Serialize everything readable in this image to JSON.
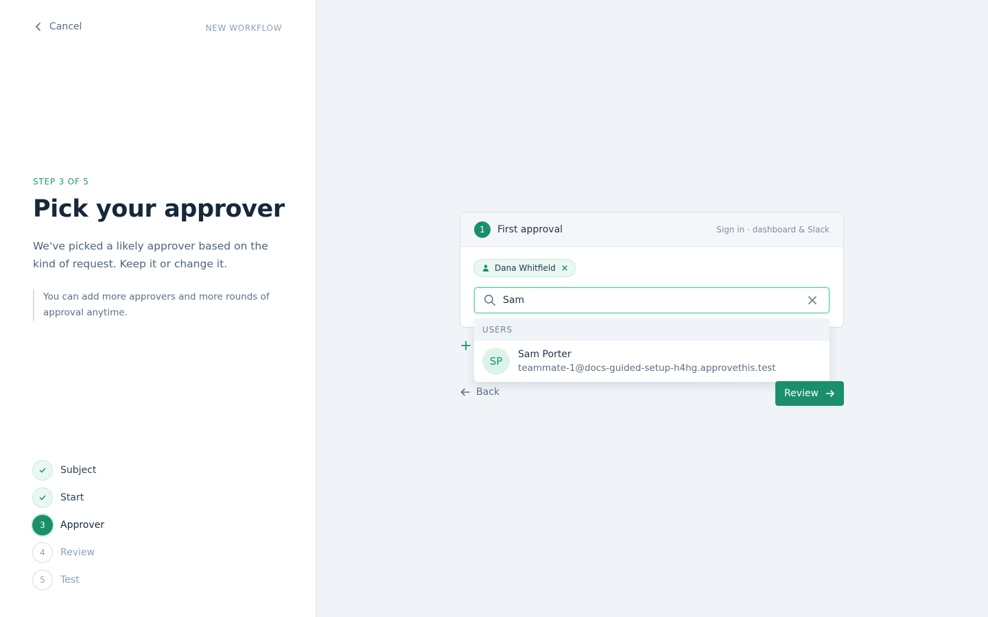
{
  "header": {
    "cancel_label": "Cancel",
    "context_label": "NEW WORKFLOW"
  },
  "intro": {
    "step_label": "STEP 3 OF 5",
    "title": "Pick your approver",
    "description": "We've picked a likely approver based on the kind of request. Keep it or change it.",
    "note": "You can add more approvers and more rounds of approval anytime."
  },
  "steps": [
    {
      "number": "1",
      "label": "Subject",
      "state": "done"
    },
    {
      "number": "2",
      "label": "Start",
      "state": "done"
    },
    {
      "number": "3",
      "label": "Approver",
      "state": "active"
    },
    {
      "number": "4",
      "label": "Review",
      "state": "todo"
    },
    {
      "number": "5",
      "label": "Test",
      "state": "todo"
    }
  ],
  "approval_card": {
    "number": "1",
    "title": "First approval",
    "subtitle": "Sign in · dashboard & Slack",
    "selected_approver": "Dana Whitfield",
    "search": {
      "value": "Sam",
      "placeholder": ""
    }
  },
  "dropdown": {
    "section_label": "USERS",
    "results": [
      {
        "initials": "SP",
        "name": "Sam Porter",
        "email": "teammate-1@docs-guided-setup-h4hg.approvethis.test"
      }
    ]
  },
  "footer": {
    "back_label": "Back",
    "review_label": "Review"
  },
  "colors": {
    "accent": "#1b8f6a",
    "accent_light": "#eaf8f2",
    "focus_border": "#48c9a1"
  },
  "icons": {
    "cancel": "chevron-left-icon",
    "check": "check-icon",
    "user": "user-icon",
    "remove": "close-icon",
    "search": "search-icon",
    "clear": "close-icon",
    "add": "plus-icon",
    "back": "arrow-left-icon",
    "next": "arrow-right-icon"
  }
}
